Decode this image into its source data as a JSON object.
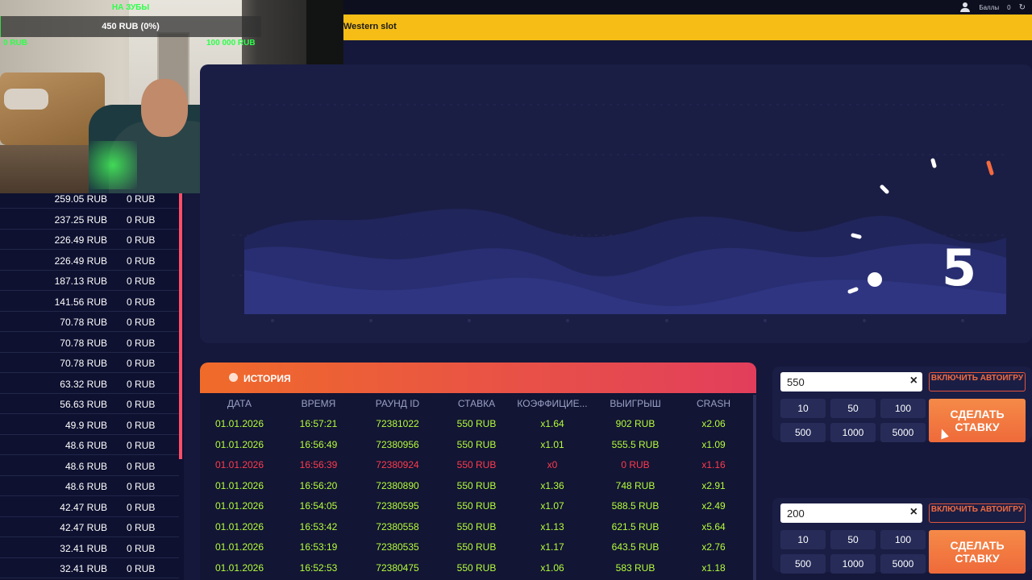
{
  "header": {
    "points_label": "Баллы",
    "points_value": "0"
  },
  "banner": {
    "text": "Western slot"
  },
  "stream": {
    "goal_label": "НА ЗУБЫ",
    "goal_progress": "450 RUB (0%)",
    "goal_fraction": 0.0045,
    "goal_min": "0 RUB",
    "goal_max": "100 000 RUB"
  },
  "left_list": [
    {
      "amount": "259.05 RUB",
      "win": "0 RUB"
    },
    {
      "amount": "237.25 RUB",
      "win": "0 RUB"
    },
    {
      "amount": "226.49 RUB",
      "win": "0 RUB"
    },
    {
      "amount": "226.49 RUB",
      "win": "0 RUB"
    },
    {
      "amount": "187.13 RUB",
      "win": "0 RUB"
    },
    {
      "amount": "141.56 RUB",
      "win": "0 RUB"
    },
    {
      "amount": "70.78 RUB",
      "win": "0 RUB"
    },
    {
      "amount": "70.78 RUB",
      "win": "0 RUB"
    },
    {
      "amount": "70.78 RUB",
      "win": "0 RUB"
    },
    {
      "amount": "63.32 RUB",
      "win": "0 RUB"
    },
    {
      "amount": "56.63 RUB",
      "win": "0 RUB"
    },
    {
      "amount": "49.9 RUB",
      "win": "0 RUB"
    },
    {
      "amount": "48.6 RUB",
      "win": "0 RUB"
    },
    {
      "amount": "48.6 RUB",
      "win": "0 RUB"
    },
    {
      "amount": "48.6 RUB",
      "win": "0 RUB"
    },
    {
      "amount": "42.47 RUB",
      "win": "0 RUB"
    },
    {
      "amount": "42.47 RUB",
      "win": "0 RUB"
    },
    {
      "amount": "32.41 RUB",
      "win": "0 RUB"
    },
    {
      "amount": "32.41 RUB",
      "win": "0 RUB"
    }
  ],
  "game": {
    "countdown": "5"
  },
  "history": {
    "title": "ИСТОРИЯ",
    "columns": [
      "ДАТА",
      "ВРЕМЯ",
      "РАУНД ID",
      "СТАВКА",
      "КОЭФФИЦИЕ...",
      "ВЫИГРЫШ",
      "CRASH"
    ],
    "rows": [
      {
        "date": "01.01.2026",
        "time": "16:57:21",
        "round": "72381022",
        "bet": "550 RUB",
        "coef": "x1.64",
        "win": "902 RUB",
        "crash": "x2.06",
        "status": "win"
      },
      {
        "date": "01.01.2026",
        "time": "16:56:49",
        "round": "72380956",
        "bet": "550 RUB",
        "coef": "x1.01",
        "win": "555.5 RUB",
        "crash": "x1.09",
        "status": "win"
      },
      {
        "date": "01.01.2026",
        "time": "16:56:39",
        "round": "72380924",
        "bet": "550 RUB",
        "coef": "x0",
        "win": "0 RUB",
        "crash": "x1.16",
        "status": "loss"
      },
      {
        "date": "01.01.2026",
        "time": "16:56:20",
        "round": "72380890",
        "bet": "550 RUB",
        "coef": "x1.36",
        "win": "748 RUB",
        "crash": "x2.91",
        "status": "win"
      },
      {
        "date": "01.01.2026",
        "time": "16:54:05",
        "round": "72380595",
        "bet": "550 RUB",
        "coef": "x1.07",
        "win": "588.5 RUB",
        "crash": "x2.49",
        "status": "win"
      },
      {
        "date": "01.01.2026",
        "time": "16:53:42",
        "round": "72380558",
        "bet": "550 RUB",
        "coef": "x1.13",
        "win": "621.5 RUB",
        "crash": "x5.64",
        "status": "win"
      },
      {
        "date": "01.01.2026",
        "time": "16:53:19",
        "round": "72380535",
        "bet": "550 RUB",
        "coef": "x1.17",
        "win": "643.5 RUB",
        "crash": "x2.76",
        "status": "win"
      },
      {
        "date": "01.01.2026",
        "time": "16:52:53",
        "round": "72380475",
        "bet": "550 RUB",
        "coef": "x1.06",
        "win": "583 RUB",
        "crash": "x1.18",
        "status": "win"
      }
    ]
  },
  "bet_panels": [
    {
      "amount": "550",
      "auto_label": "ВКЛЮЧИТЬ АВТОИГРУ",
      "chips": [
        "10",
        "50",
        "100",
        "500",
        "1000",
        "5000"
      ],
      "bet_label": "СДЕЛАТЬ СТАВКУ"
    },
    {
      "amount": "200",
      "auto_label": "ВКЛЮЧИТЬ АВТОИГРУ",
      "chips": [
        "10",
        "50",
        "100",
        "500",
        "1000",
        "5000"
      ],
      "bet_label": "СДЕЛАТЬ СТАВКУ"
    }
  ],
  "colors": {
    "win": "#b6ff3a",
    "loss": "#ff3b4e",
    "banner": "#f6bd16",
    "accent": "#ef6a3a"
  }
}
